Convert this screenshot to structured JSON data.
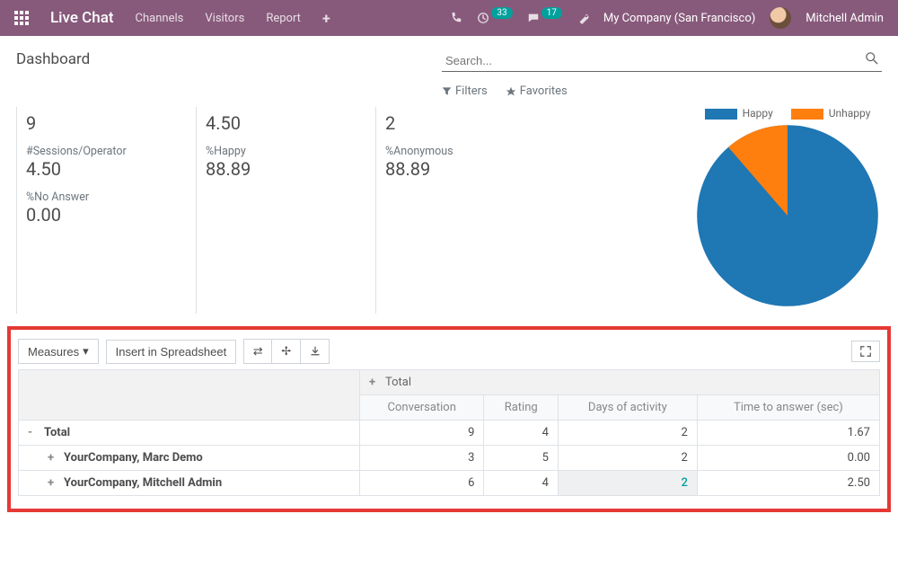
{
  "navbar": {
    "brand": "Live Chat",
    "links": [
      "Channels",
      "Visitors",
      "Report"
    ],
    "badge1": "33",
    "badge2": "17",
    "company": "My Company (San Francisco)",
    "user": "Mitchell Admin"
  },
  "header": {
    "title": "Dashboard",
    "search_placeholder": "Search...",
    "filters_label": "Filters",
    "favorites_label": "Favorites"
  },
  "kpi": {
    "r1": [
      {
        "value": "9"
      },
      {
        "value": "4.50"
      },
      {
        "value": "2"
      }
    ],
    "r2": [
      {
        "label": "#Sessions/Operator",
        "value": "4.50"
      },
      {
        "label": "%Happy",
        "value": "88.89"
      },
      {
        "label": "%Anonymous",
        "value": "88.89"
      }
    ],
    "r3": [
      {
        "label": "%No Answer",
        "value": "0.00"
      }
    ]
  },
  "chart_data": {
    "type": "pie",
    "title": "",
    "series": [
      {
        "name": "Happy",
        "value": 88.89,
        "color": "#1f77b4"
      },
      {
        "name": "Unhappy",
        "value": 11.11,
        "color": "#ff7f0e"
      }
    ]
  },
  "pivot": {
    "measures_btn": "Measures",
    "insert_btn": "Insert in Spreadsheet",
    "total_label": "Total",
    "columns": [
      "Conversation",
      "Rating",
      "Days of activity",
      "Time to answer (sec)"
    ],
    "rows": [
      {
        "name": "Total",
        "expand": "-",
        "indent": 0,
        "values": [
          "9",
          "4",
          "2",
          "1.67"
        ],
        "hl": [
          false,
          false,
          false,
          false
        ]
      },
      {
        "name": "YourCompany, Marc Demo",
        "expand": "+",
        "indent": 1,
        "values": [
          "3",
          "5",
          "2",
          "0.00"
        ],
        "hl": [
          false,
          false,
          false,
          false
        ]
      },
      {
        "name": "YourCompany, Mitchell Admin",
        "expand": "+",
        "indent": 1,
        "values": [
          "6",
          "4",
          "2",
          "2.50"
        ],
        "hl": [
          false,
          false,
          true,
          false
        ],
        "teal_idx": 2
      }
    ]
  }
}
